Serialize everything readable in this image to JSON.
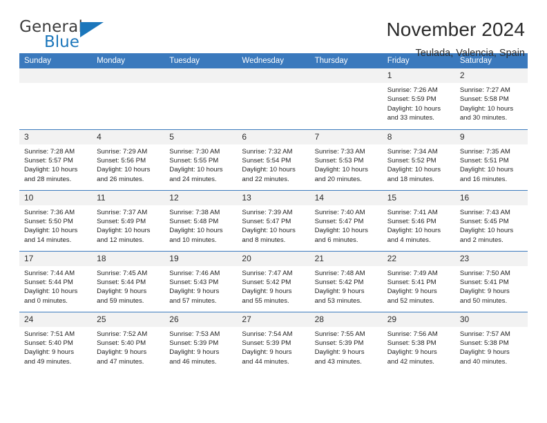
{
  "brand": {
    "name_part1": "General",
    "name_part2": "Blue",
    "accent_color": "#1b76bb"
  },
  "header": {
    "title": "November 2024",
    "subtitle": "Teulada, Valencia, Spain"
  },
  "theme": {
    "header_row_color": "#3a79bd",
    "daynum_band_color": "#f2f2f2",
    "cell_background": "#ffffff"
  },
  "weekday_headers": [
    "Sunday",
    "Monday",
    "Tuesday",
    "Wednesday",
    "Thursday",
    "Friday",
    "Saturday"
  ],
  "weeks": [
    [
      {
        "day": "",
        "sunrise": "",
        "sunset": "",
        "daylight_1": "",
        "daylight_2": ""
      },
      {
        "day": "",
        "sunrise": "",
        "sunset": "",
        "daylight_1": "",
        "daylight_2": ""
      },
      {
        "day": "",
        "sunrise": "",
        "sunset": "",
        "daylight_1": "",
        "daylight_2": ""
      },
      {
        "day": "",
        "sunrise": "",
        "sunset": "",
        "daylight_1": "",
        "daylight_2": ""
      },
      {
        "day": "",
        "sunrise": "",
        "sunset": "",
        "daylight_1": "",
        "daylight_2": ""
      },
      {
        "day": "1",
        "sunrise": "Sunrise: 7:26 AM",
        "sunset": "Sunset: 5:59 PM",
        "daylight_1": "Daylight: 10 hours",
        "daylight_2": "and 33 minutes."
      },
      {
        "day": "2",
        "sunrise": "Sunrise: 7:27 AM",
        "sunset": "Sunset: 5:58 PM",
        "daylight_1": "Daylight: 10 hours",
        "daylight_2": "and 30 minutes."
      }
    ],
    [
      {
        "day": "3",
        "sunrise": "Sunrise: 7:28 AM",
        "sunset": "Sunset: 5:57 PM",
        "daylight_1": "Daylight: 10 hours",
        "daylight_2": "and 28 minutes."
      },
      {
        "day": "4",
        "sunrise": "Sunrise: 7:29 AM",
        "sunset": "Sunset: 5:56 PM",
        "daylight_1": "Daylight: 10 hours",
        "daylight_2": "and 26 minutes."
      },
      {
        "day": "5",
        "sunrise": "Sunrise: 7:30 AM",
        "sunset": "Sunset: 5:55 PM",
        "daylight_1": "Daylight: 10 hours",
        "daylight_2": "and 24 minutes."
      },
      {
        "day": "6",
        "sunrise": "Sunrise: 7:32 AM",
        "sunset": "Sunset: 5:54 PM",
        "daylight_1": "Daylight: 10 hours",
        "daylight_2": "and 22 minutes."
      },
      {
        "day": "7",
        "sunrise": "Sunrise: 7:33 AM",
        "sunset": "Sunset: 5:53 PM",
        "daylight_1": "Daylight: 10 hours",
        "daylight_2": "and 20 minutes."
      },
      {
        "day": "8",
        "sunrise": "Sunrise: 7:34 AM",
        "sunset": "Sunset: 5:52 PM",
        "daylight_1": "Daylight: 10 hours",
        "daylight_2": "and 18 minutes."
      },
      {
        "day": "9",
        "sunrise": "Sunrise: 7:35 AM",
        "sunset": "Sunset: 5:51 PM",
        "daylight_1": "Daylight: 10 hours",
        "daylight_2": "and 16 minutes."
      }
    ],
    [
      {
        "day": "10",
        "sunrise": "Sunrise: 7:36 AM",
        "sunset": "Sunset: 5:50 PM",
        "daylight_1": "Daylight: 10 hours",
        "daylight_2": "and 14 minutes."
      },
      {
        "day": "11",
        "sunrise": "Sunrise: 7:37 AM",
        "sunset": "Sunset: 5:49 PM",
        "daylight_1": "Daylight: 10 hours",
        "daylight_2": "and 12 minutes."
      },
      {
        "day": "12",
        "sunrise": "Sunrise: 7:38 AM",
        "sunset": "Sunset: 5:48 PM",
        "daylight_1": "Daylight: 10 hours",
        "daylight_2": "and 10 minutes."
      },
      {
        "day": "13",
        "sunrise": "Sunrise: 7:39 AM",
        "sunset": "Sunset: 5:47 PM",
        "daylight_1": "Daylight: 10 hours",
        "daylight_2": "and 8 minutes."
      },
      {
        "day": "14",
        "sunrise": "Sunrise: 7:40 AM",
        "sunset": "Sunset: 5:47 PM",
        "daylight_1": "Daylight: 10 hours",
        "daylight_2": "and 6 minutes."
      },
      {
        "day": "15",
        "sunrise": "Sunrise: 7:41 AM",
        "sunset": "Sunset: 5:46 PM",
        "daylight_1": "Daylight: 10 hours",
        "daylight_2": "and 4 minutes."
      },
      {
        "day": "16",
        "sunrise": "Sunrise: 7:43 AM",
        "sunset": "Sunset: 5:45 PM",
        "daylight_1": "Daylight: 10 hours",
        "daylight_2": "and 2 minutes."
      }
    ],
    [
      {
        "day": "17",
        "sunrise": "Sunrise: 7:44 AM",
        "sunset": "Sunset: 5:44 PM",
        "daylight_1": "Daylight: 10 hours",
        "daylight_2": "and 0 minutes."
      },
      {
        "day": "18",
        "sunrise": "Sunrise: 7:45 AM",
        "sunset": "Sunset: 5:44 PM",
        "daylight_1": "Daylight: 9 hours",
        "daylight_2": "and 59 minutes."
      },
      {
        "day": "19",
        "sunrise": "Sunrise: 7:46 AM",
        "sunset": "Sunset: 5:43 PM",
        "daylight_1": "Daylight: 9 hours",
        "daylight_2": "and 57 minutes."
      },
      {
        "day": "20",
        "sunrise": "Sunrise: 7:47 AM",
        "sunset": "Sunset: 5:42 PM",
        "daylight_1": "Daylight: 9 hours",
        "daylight_2": "and 55 minutes."
      },
      {
        "day": "21",
        "sunrise": "Sunrise: 7:48 AM",
        "sunset": "Sunset: 5:42 PM",
        "daylight_1": "Daylight: 9 hours",
        "daylight_2": "and 53 minutes."
      },
      {
        "day": "22",
        "sunrise": "Sunrise: 7:49 AM",
        "sunset": "Sunset: 5:41 PM",
        "daylight_1": "Daylight: 9 hours",
        "daylight_2": "and 52 minutes."
      },
      {
        "day": "23",
        "sunrise": "Sunrise: 7:50 AM",
        "sunset": "Sunset: 5:41 PM",
        "daylight_1": "Daylight: 9 hours",
        "daylight_2": "and 50 minutes."
      }
    ],
    [
      {
        "day": "24",
        "sunrise": "Sunrise: 7:51 AM",
        "sunset": "Sunset: 5:40 PM",
        "daylight_1": "Daylight: 9 hours",
        "daylight_2": "and 49 minutes."
      },
      {
        "day": "25",
        "sunrise": "Sunrise: 7:52 AM",
        "sunset": "Sunset: 5:40 PM",
        "daylight_1": "Daylight: 9 hours",
        "daylight_2": "and 47 minutes."
      },
      {
        "day": "26",
        "sunrise": "Sunrise: 7:53 AM",
        "sunset": "Sunset: 5:39 PM",
        "daylight_1": "Daylight: 9 hours",
        "daylight_2": "and 46 minutes."
      },
      {
        "day": "27",
        "sunrise": "Sunrise: 7:54 AM",
        "sunset": "Sunset: 5:39 PM",
        "daylight_1": "Daylight: 9 hours",
        "daylight_2": "and 44 minutes."
      },
      {
        "day": "28",
        "sunrise": "Sunrise: 7:55 AM",
        "sunset": "Sunset: 5:39 PM",
        "daylight_1": "Daylight: 9 hours",
        "daylight_2": "and 43 minutes."
      },
      {
        "day": "29",
        "sunrise": "Sunrise: 7:56 AM",
        "sunset": "Sunset: 5:38 PM",
        "daylight_1": "Daylight: 9 hours",
        "daylight_2": "and 42 minutes."
      },
      {
        "day": "30",
        "sunrise": "Sunrise: 7:57 AM",
        "sunset": "Sunset: 5:38 PM",
        "daylight_1": "Daylight: 9 hours",
        "daylight_2": "and 40 minutes."
      }
    ]
  ]
}
